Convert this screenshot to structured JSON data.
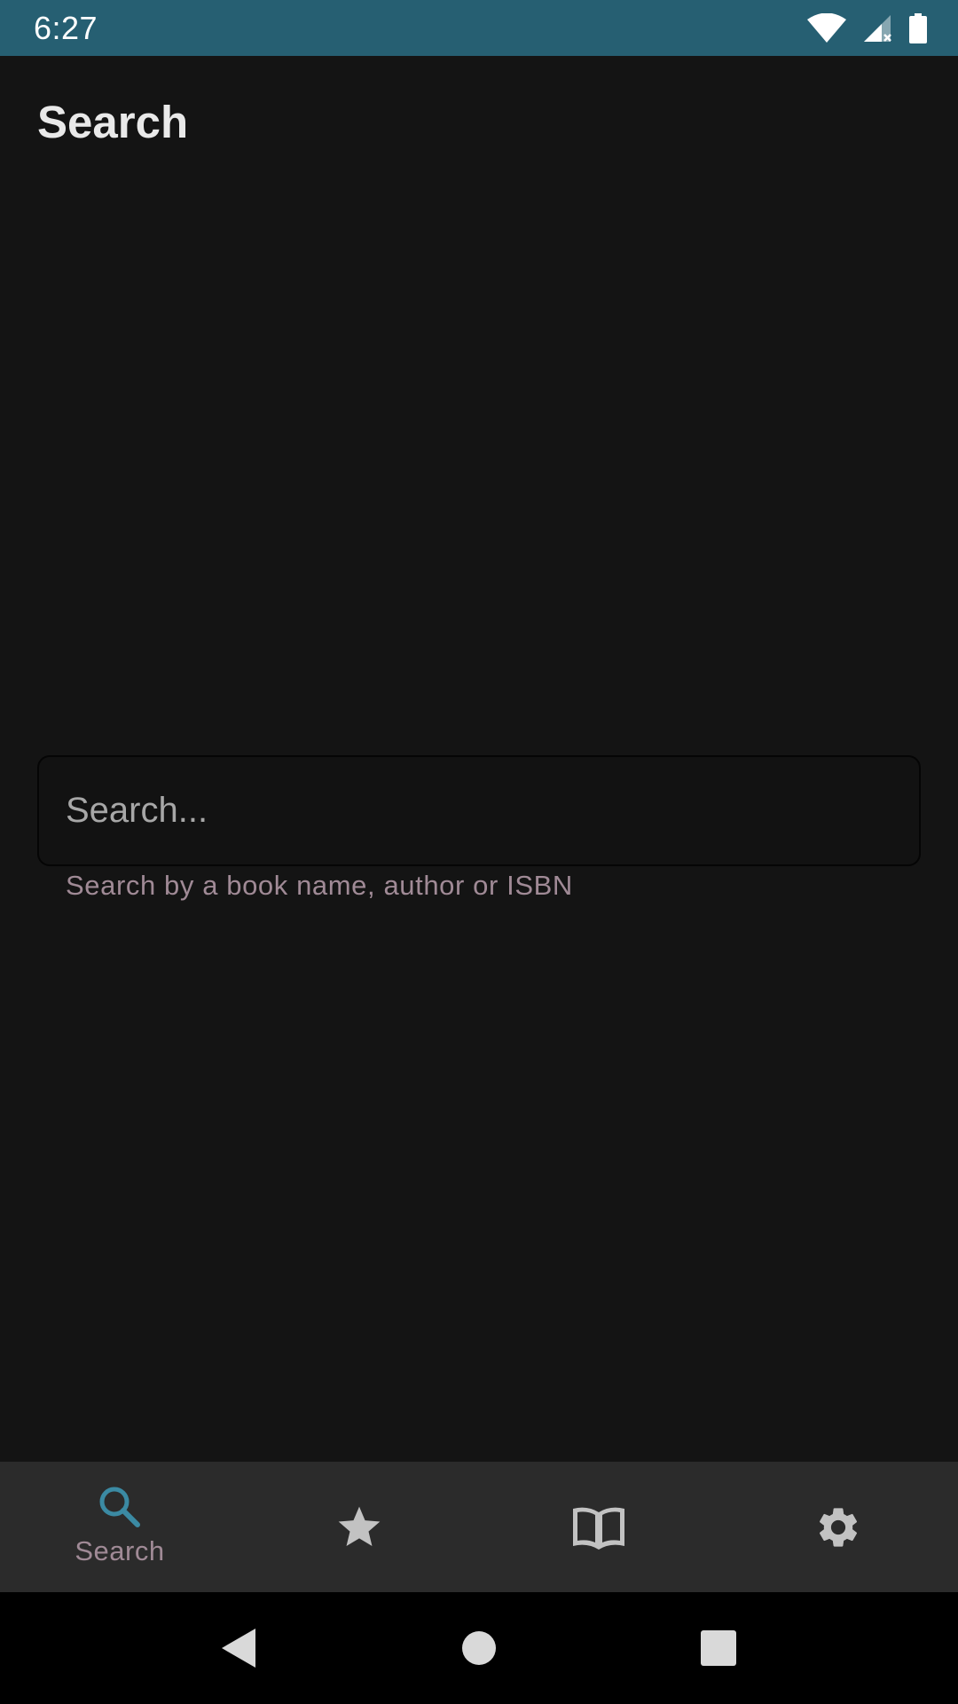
{
  "status_bar": {
    "time": "6:27",
    "icons": [
      "wifi-icon",
      "signal-icon",
      "battery-icon"
    ],
    "background": "#265f72"
  },
  "app_bar": {
    "title": "Search"
  },
  "search": {
    "placeholder": "Search...",
    "value": "",
    "helper_text": "Search by a book name, author or ISBN"
  },
  "bottom_nav": {
    "items": [
      {
        "icon": "search-icon",
        "label": "Search",
        "active": true
      },
      {
        "icon": "star-icon",
        "label": "",
        "active": false
      },
      {
        "icon": "book-icon",
        "label": "",
        "active": false
      },
      {
        "icon": "gear-icon",
        "label": "",
        "active": false
      }
    ],
    "active_color": "#3b8aa3",
    "inactive_color": "#c2c2c2"
  },
  "system_nav": {
    "buttons": [
      "back-icon",
      "home-icon",
      "recents-icon"
    ]
  }
}
